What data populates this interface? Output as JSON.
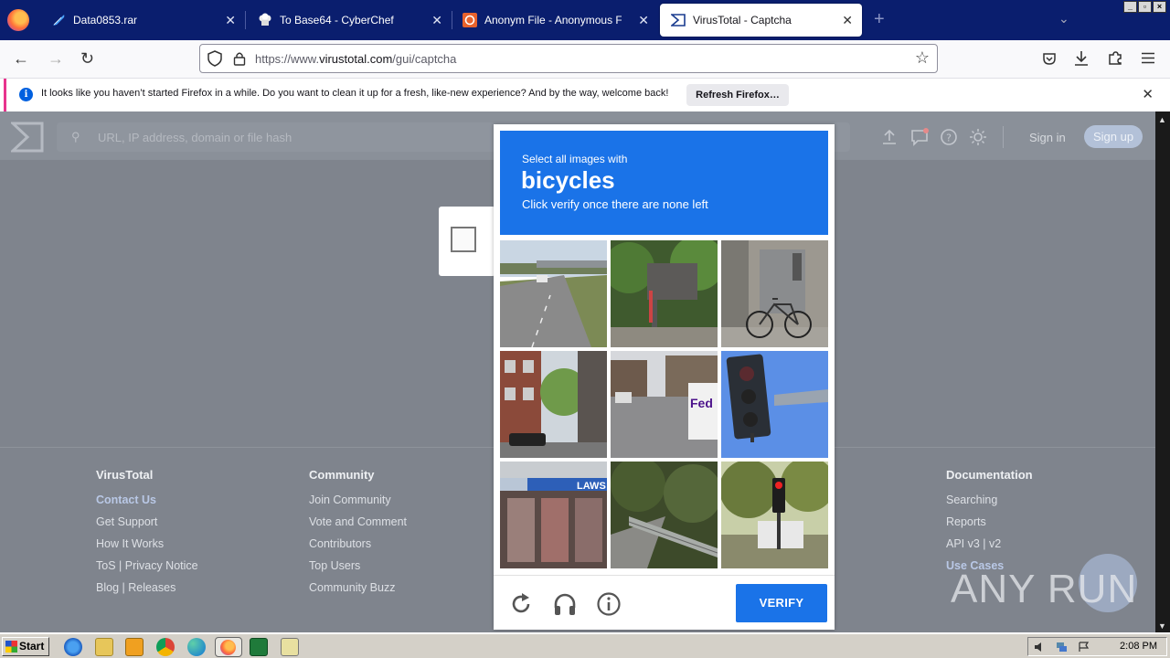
{
  "browser": {
    "tabs": [
      {
        "label": "Data0853.rar",
        "icon": "rar-feather-icon"
      },
      {
        "label": "To Base64 - CyberChef",
        "icon": "chef-hat-icon"
      },
      {
        "label": "Anonym File - Anonymous File Uplo",
        "icon": "anonymfile-icon"
      },
      {
        "label": "VirusTotal - Captcha",
        "icon": "virustotal-icon"
      }
    ],
    "window_controls": [
      "_",
      "▫",
      "×"
    ],
    "url_host": "https://www.",
    "url_domain": "virustotal.com",
    "url_path": "/gui/captcha"
  },
  "notification": {
    "message": "It looks like you haven’t started Firefox in a while. Do you want to clean it up for a fresh, like-new experience? And by the way, welcome back!",
    "button": "Refresh Firefox…"
  },
  "virustotal": {
    "search_placeholder": "URL, IP address, domain or file hash",
    "sign_in": "Sign in",
    "sign_up": "Sign up"
  },
  "captcha": {
    "line1": "Select all images with",
    "target": "bicycles",
    "line3": "Click verify once there are none left",
    "verify": "VERIFY",
    "tiles": [
      "highway-road",
      "overpass-trees",
      "bicycle-by-building",
      "brick-apartment-street",
      "street-fedex-van",
      "traffic-light-blue-sky",
      "lawson-storefront",
      "guardrail-road",
      "traffic-light-trees"
    ]
  },
  "footer": {
    "columns": [
      {
        "heading": "VirusTotal",
        "links": [
          "Contact Us",
          "Get Support",
          "How It Works",
          "ToS | Privacy Notice",
          "Blog | Releases"
        ]
      },
      {
        "heading": "Community",
        "links": [
          "Join Community",
          "Vote and Comment",
          "Contributors",
          "Top Users",
          "Community Buzz"
        ]
      },
      {
        "heading": "Documentation",
        "links": [
          "Searching",
          "Reports",
          "API v3 | v2",
          "Use Cases"
        ]
      }
    ]
  },
  "watermark": "ANY RUN",
  "taskbar": {
    "start": "Start",
    "clock": "2:08 PM"
  },
  "colors": {
    "accent": "#1a73e8",
    "tabbar": "#0a1e6e",
    "overlay_gray": "#7f848d"
  }
}
